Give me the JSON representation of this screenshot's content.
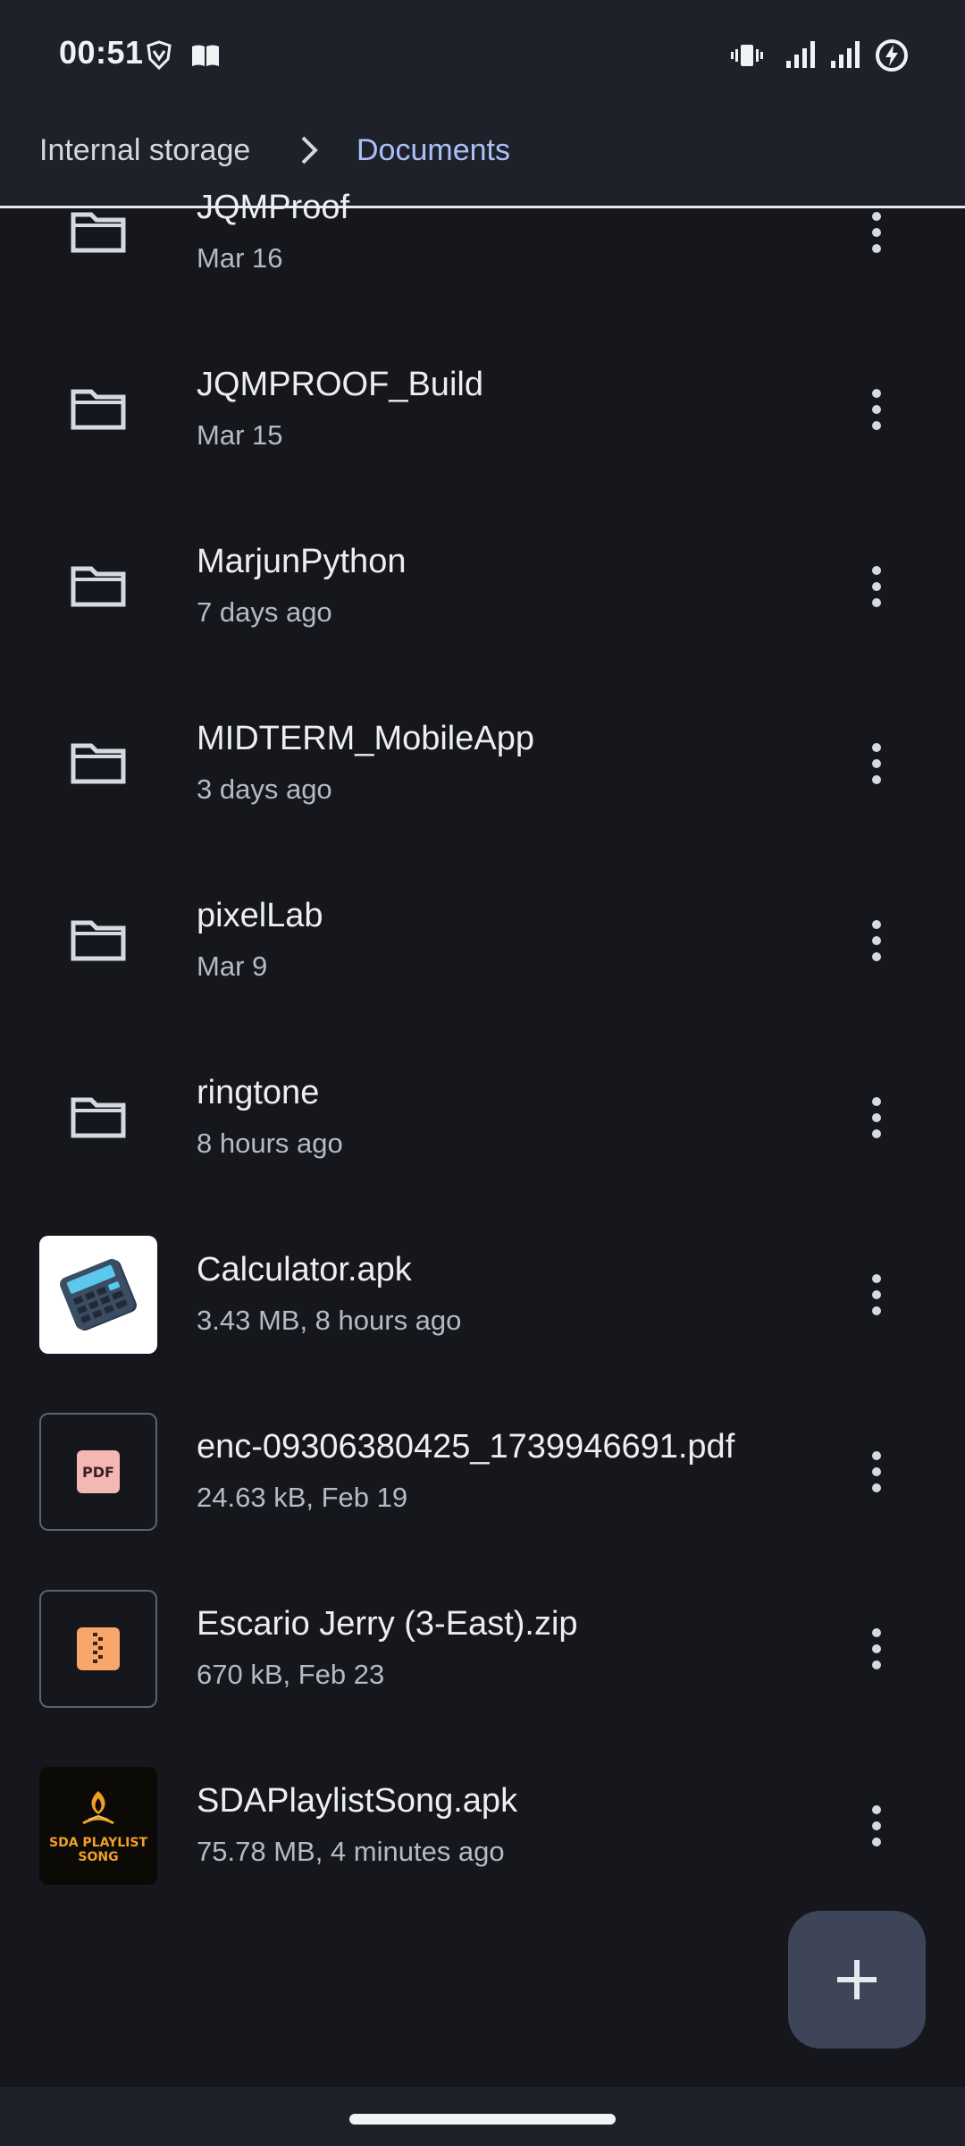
{
  "status_bar": {
    "time": "00:51",
    "left_icons": [
      "brave-shield-icon",
      "book-icon"
    ],
    "right_icons": [
      "vibrate-icon",
      "signal-1-icon",
      "signal-2-icon",
      "battery-charging-icon"
    ]
  },
  "breadcrumb": {
    "root": "Internal storage",
    "separator_icon": "chevron-right-icon",
    "current": "Documents"
  },
  "files": [
    {
      "name": "JQMProof",
      "meta": "Mar 16",
      "kind": "folder"
    },
    {
      "name": "JQMPROOF_Build",
      "meta": "Mar 15",
      "kind": "folder"
    },
    {
      "name": "MarjunPython",
      "meta": "7 days ago",
      "kind": "folder"
    },
    {
      "name": "MIDTERM_MobileApp",
      "meta": "3 days ago",
      "kind": "folder"
    },
    {
      "name": "pixelLab",
      "meta": "Mar 9",
      "kind": "folder"
    },
    {
      "name": "ringtone",
      "meta": "8 hours ago",
      "kind": "folder"
    },
    {
      "name": "Calculator.apk",
      "meta": "3.43 MB, 8 hours ago",
      "kind": "apk-calculator"
    },
    {
      "name": "enc-09306380425_1739946691.pdf",
      "meta": "24.63 kB, Feb 19",
      "kind": "pdf",
      "badge": "PDF"
    },
    {
      "name": "Escario Jerry (3-East).zip",
      "meta": "670 kB, Feb 23",
      "kind": "zip"
    },
    {
      "name": "SDAPlaylistSong.apk",
      "meta": "75.78 MB, 4 minutes ago",
      "kind": "apk-sda",
      "thumb_text": [
        "SDA PLAYLIST",
        "SONG"
      ]
    }
  ],
  "fab": {
    "icon": "plus-icon"
  },
  "colors": {
    "background": "#15171d",
    "bar": "#1e212a",
    "accent": "#a9c1f5",
    "fab": "#3f4559",
    "pdf_badge": "#f4b8b4",
    "zip_badge": "#f8a66a"
  }
}
